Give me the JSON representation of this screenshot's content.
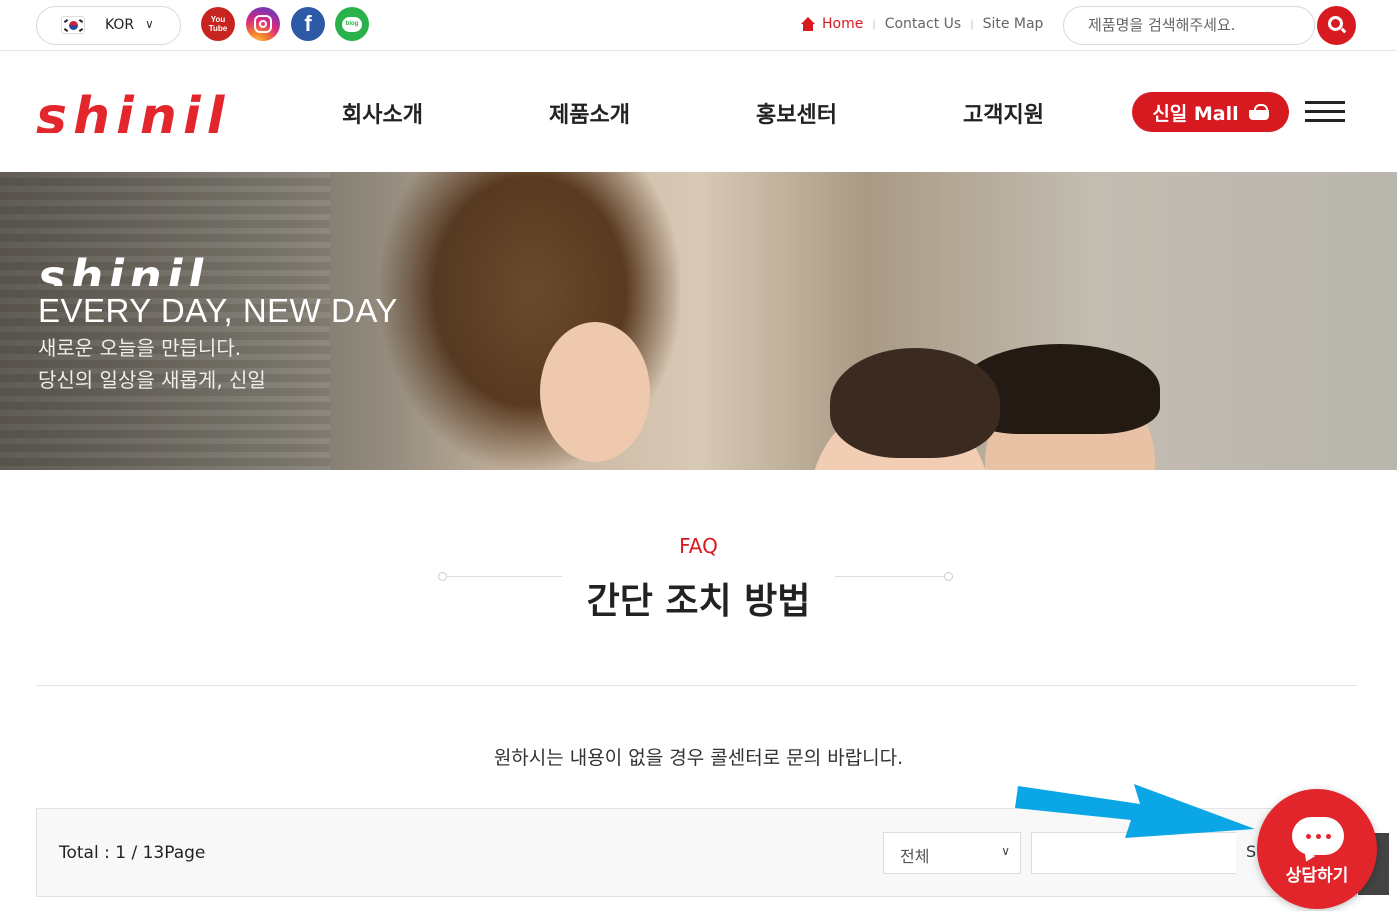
{
  "topbar": {
    "language": "KOR",
    "social_icons": [
      "youtube-icon",
      "instagram-icon",
      "facebook-icon",
      "blog-icon"
    ],
    "youtube_text": "You Tube",
    "blog_text": "blog",
    "links": {
      "home": "Home",
      "contact": "Contact Us",
      "sitemap": "Site Map"
    },
    "search_placeholder": "제품명을 검색해주세요."
  },
  "header": {
    "logo": "shinil",
    "nav": [
      "회사소개",
      "제품소개",
      "홍보센터",
      "고객지원"
    ],
    "mall_button": "신일 Mall"
  },
  "hero": {
    "logo": "shinil",
    "tagline": "EVERY DAY, NEW DAY",
    "sub1": "새로운 오늘을 만듭니다.",
    "sub2": "당신의 일상을 새롭게, 신일"
  },
  "content": {
    "section_label": "FAQ",
    "title": "간단 조치 방법",
    "notice": "원하시는 내용이 없을 경우 콜센터로 문의 바랍니다."
  },
  "list": {
    "total": "Total : 1 / 13Page",
    "filter_value": "전체",
    "keyword_value": "",
    "search_button_partial": "S"
  },
  "chat": {
    "label": "상담하기"
  },
  "colors": {
    "brand_red": "#d71920",
    "arrow_blue": "#0aa6e6"
  }
}
